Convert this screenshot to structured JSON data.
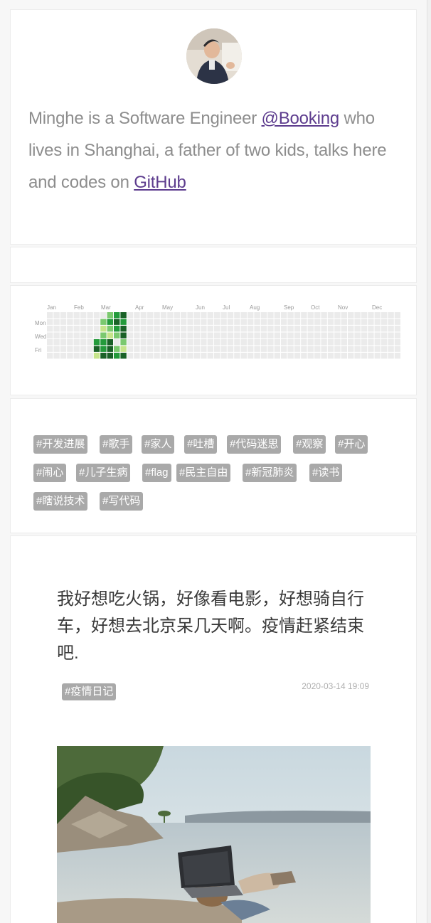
{
  "profile": {
    "bio_prefix": "Minghe is a Software Engineer ",
    "employer_link": "@Booking",
    "bio_middle": " who lives in Shanghai, a father of two kids, talks here and codes on ",
    "github_link": "GitHub"
  },
  "heatmap": {
    "months": [
      "Jan",
      "Feb",
      "Mar",
      "Apr",
      "May",
      "Jun",
      "Jul",
      "Aug",
      "Sep",
      "Oct",
      "Nov",
      "Dec"
    ],
    "days": [
      "Mon",
      "Wed",
      "Fri"
    ],
    "colors": {
      "empty": "#ebebeb",
      "l1": "#c6e48b",
      "l2": "#7bc96f",
      "l3": "#239a3b",
      "l4": "#196127"
    }
  },
  "tags": {
    "items": [
      "#开发进展",
      "#歌手",
      "#家人",
      "#吐槽",
      "#代码迷思",
      "#观察",
      "#开心",
      "#闹心",
      "#儿子生病",
      "#flag",
      "#民主自由",
      "#新冠肺炎",
      "#读书",
      "#瞎说技术",
      "#写代码"
    ]
  },
  "post": {
    "text": "我好想吃火锅，好像看电影，好想骑自行车，好想去北京呆几天啊。疫情赶紧结束吧.",
    "tag": "#疫情日记",
    "timestamp": "2020-03-14 19:09"
  }
}
